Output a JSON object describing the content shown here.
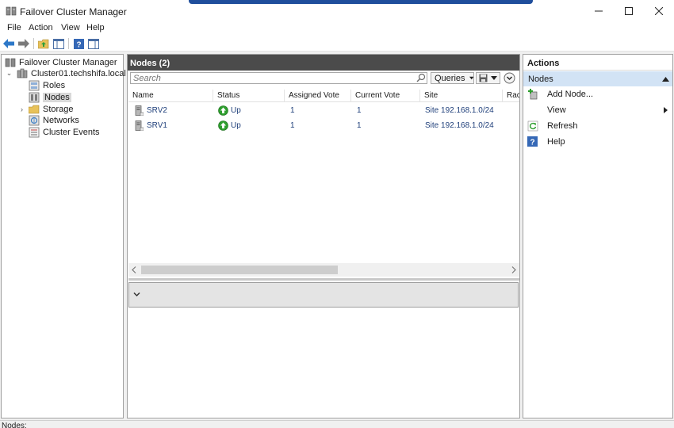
{
  "window": {
    "title": "Failover Cluster Manager"
  },
  "menu": [
    "File",
    "Action",
    "View",
    "Help"
  ],
  "tree": {
    "root": "Failover Cluster Manager",
    "cluster": "Cluster01.techshifa.local",
    "items": [
      "Roles",
      "Nodes",
      "Storage",
      "Networks",
      "Cluster Events"
    ]
  },
  "center": {
    "header": "Nodes (2)",
    "search_placeholder": "Search",
    "queries_label": "Queries",
    "columns": [
      "Name",
      "Status",
      "Assigned Vote",
      "Current Vote",
      "Site",
      "Rac"
    ],
    "rows": [
      {
        "name": "SRV2",
        "status": "Up",
        "assigned_vote": "1",
        "current_vote": "1",
        "site": "Site 192.168.1.0/24"
      },
      {
        "name": "SRV1",
        "status": "Up",
        "assigned_vote": "1",
        "current_vote": "1",
        "site": "Site 192.168.1.0/24"
      }
    ]
  },
  "actions": {
    "title": "Actions",
    "section": "Nodes",
    "items": [
      "Add Node...",
      "View",
      "Refresh",
      "Help"
    ]
  },
  "status": {
    "text": "Nodes:"
  },
  "colors": {
    "accent": "#1f4e9c",
    "header_bg": "#4b4b4b",
    "section_bg": "#d2e3f5",
    "status_up": "#2e9e2e"
  }
}
